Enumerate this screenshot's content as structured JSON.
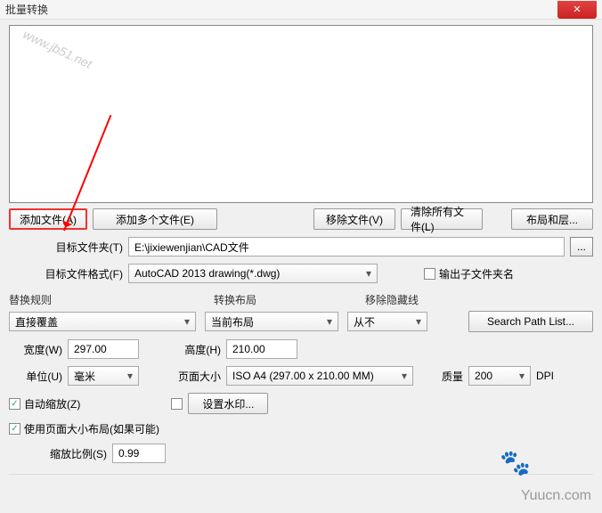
{
  "title": "批量转换",
  "watermark": "www.jb51.net",
  "buttons": {
    "add_file": "添加文件(A)",
    "add_multiple": "添加多个文件(E)",
    "remove_file": "移除文件(V)",
    "clear_all": "清除所有文件(L)",
    "layout_layers": "布局和层..."
  },
  "target_folder": {
    "label": "目标文件夹(T)",
    "value": "E:\\jixiewenjian\\CAD文件",
    "browse": "..."
  },
  "target_format": {
    "label": "目标文件格式(F)",
    "value": "AutoCAD 2013 drawing(*.dwg)"
  },
  "output_subfolder_checkbox": "输出子文件夹名",
  "sections": {
    "replace_rule": "替换规则",
    "convert_layout": "转换布局",
    "remove_hidden": "移除隐藏线"
  },
  "replace_rule_value": "直接覆盖",
  "convert_layout_value": "当前布局",
  "remove_hidden_value": "从不",
  "search_path_btn": "Search Path List...",
  "width": {
    "label": "宽度(W)",
    "value": "297.00"
  },
  "height": {
    "label": "高度(H)",
    "value": "210.00"
  },
  "unit": {
    "label": "单位(U)",
    "value": "毫米"
  },
  "page_size": {
    "label": "页面大小",
    "value": "ISO A4 (297.00 x 210.00 MM)"
  },
  "quality": {
    "label": "质量",
    "value": "200",
    "suffix": "DPI"
  },
  "auto_zoom": "自动缩放(Z)",
  "set_watermark_btn": "设置水印...",
  "use_page_layout": "使用页面大小布局(如果可能)",
  "zoom_ratio": {
    "label": "缩放比例(S)",
    "value": "0.99"
  },
  "footer_brand": "Yuucn.com"
}
